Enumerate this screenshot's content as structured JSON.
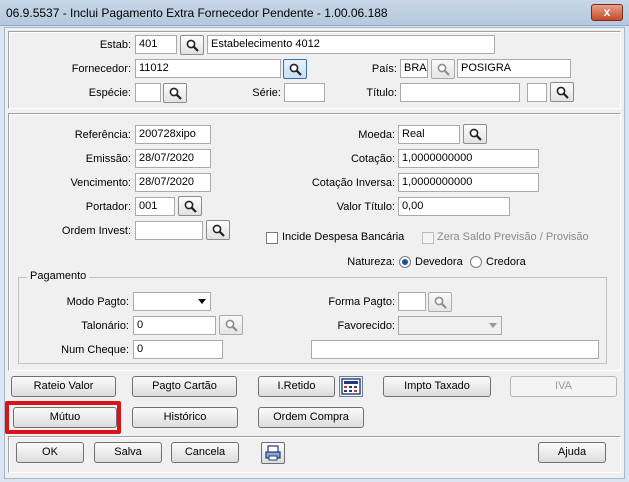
{
  "window": {
    "title": "06.9.5537 - Inclui Pagamento Extra Fornecedor Pendente - 1.00.06.188",
    "close_label": "x"
  },
  "header": {
    "estab_label": "Estab:",
    "estab_code": "401",
    "estab_name": "Estabelecimento 4012",
    "fornecedor_label": "Fornecedor:",
    "fornecedor_code": "11012",
    "pais_label": "País:",
    "pais_code": "BRA",
    "pais_name": "POSIGRA",
    "especie_label": "Espécie:",
    "especie_value": "",
    "serie_label": "Série:",
    "serie_value": "",
    "titulo_label": "Título:",
    "titulo_value": "",
    "titulo_parcela": ""
  },
  "details": {
    "referencia_label": "Referência:",
    "referencia_value": "200728xipo",
    "emissao_label": "Emissão:",
    "emissao_value": "28/07/2020",
    "vencimento_label": "Vencimento:",
    "vencimento_value": "28/07/2020",
    "portador_label": "Portador:",
    "portador_value": "001",
    "ordem_invest_label": "Ordem Invest:",
    "ordem_invest_value": "",
    "moeda_label": "Moeda:",
    "moeda_value": "Real",
    "cotacao_label": "Cotação:",
    "cotacao_value": "1,0000000000",
    "cotacao_inversa_label": "Cotação Inversa:",
    "cotacao_inversa_value": "1,0000000000",
    "valor_titulo_label": "Valor Título:",
    "valor_titulo_value": "0,00",
    "incide_despesa_label": "Incide Despesa Bancária",
    "zera_saldo_label": "Zera Saldo Previsão / Provisão",
    "natureza_label": "Natureza:",
    "devedora_label": "Devedora",
    "credora_label": "Credora"
  },
  "pagamento": {
    "group_title": "Pagamento",
    "modo_pagto_label": "Modo Pagto:",
    "modo_pagto_value": "",
    "forma_pagto_label": "Forma Pagto:",
    "forma_pagto_value": "",
    "talonario_label": "Talonário:",
    "talonario_value": "0",
    "favorecido_label": "Favorecido:",
    "favorecido_value": "",
    "num_cheque_label": "Num Cheque:",
    "num_cheque_value": "0",
    "extra_value": ""
  },
  "actions": {
    "rateio_valor": "Rateio Valor",
    "pagto_cartao": "Pagto Cartão",
    "i_retido": "I.Retido",
    "impto_taxado": "Impto Taxado",
    "iva": "IVA",
    "mutuo": "Mútuo",
    "historico": "Histórico",
    "ordem_compra": "Ordem Compra"
  },
  "footer": {
    "ok": "OK",
    "salva": "Salva",
    "cancela": "Cancela",
    "ajuda": "Ajuda"
  },
  "colors": {
    "highlight": "#d8141a",
    "radio_selected": "#1a4fa0"
  }
}
